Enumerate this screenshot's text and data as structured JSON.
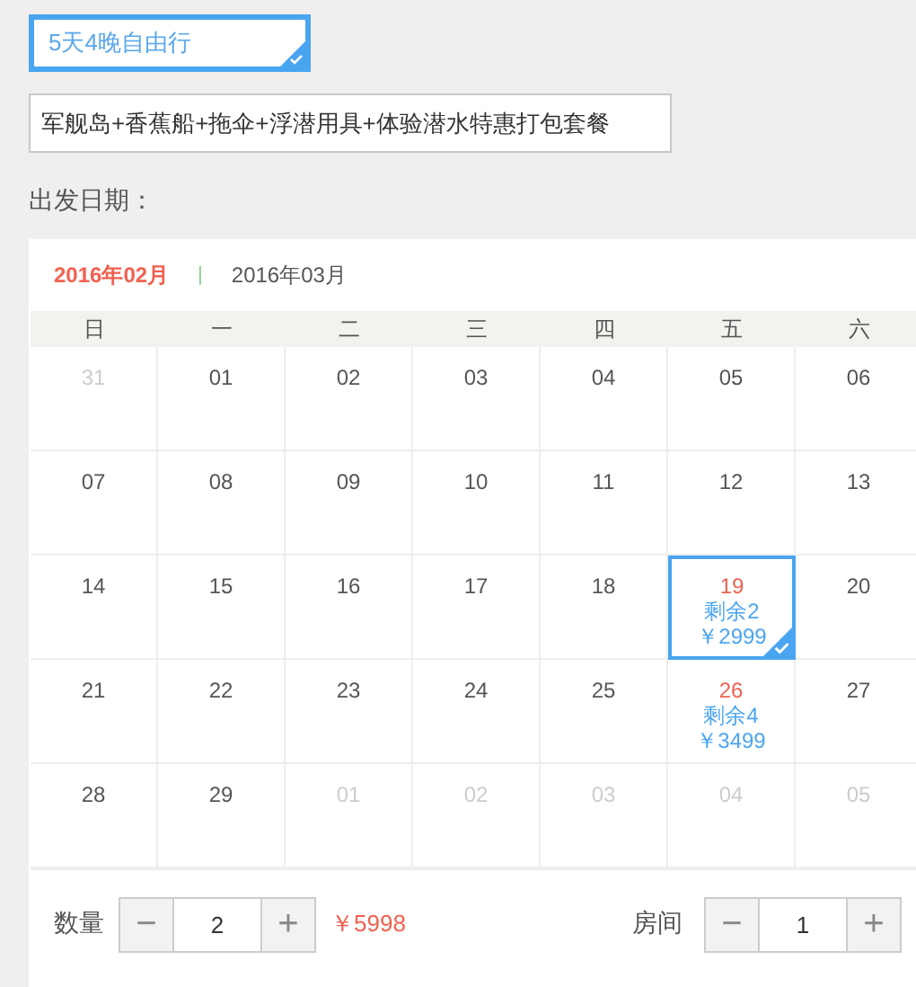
{
  "packages": [
    {
      "label": "5天4晚自由行",
      "selected": true
    }
  ],
  "options": [
    {
      "label": "军舰岛+香蕉船+拖伞+浮潜用具+体验潜水特惠打包套餐",
      "selected": false
    }
  ],
  "date_label": "出发日期：",
  "months": [
    {
      "label": "2016年02月",
      "selected": true
    },
    {
      "label": "2016年03月",
      "selected": false
    }
  ],
  "separator": "|",
  "weekdays": [
    "日",
    "一",
    "二",
    "三",
    "四",
    "五",
    "六"
  ],
  "weeks": [
    [
      {
        "day": "31",
        "muted": true,
        "selected": false
      },
      {
        "day": "01",
        "muted": false,
        "selected": false
      },
      {
        "day": "02",
        "muted": false,
        "selected": false
      },
      {
        "day": "03",
        "muted": false,
        "selected": false
      },
      {
        "day": "04",
        "muted": false,
        "selected": false
      },
      {
        "day": "05",
        "muted": false,
        "selected": false
      },
      {
        "day": "06",
        "muted": false,
        "selected": false
      }
    ],
    [
      {
        "day": "07",
        "muted": false,
        "selected": false
      },
      {
        "day": "08",
        "muted": false,
        "selected": false
      },
      {
        "day": "09",
        "muted": false,
        "selected": false
      },
      {
        "day": "10",
        "muted": false,
        "selected": false
      },
      {
        "day": "11",
        "muted": false,
        "selected": false
      },
      {
        "day": "12",
        "muted": false,
        "selected": false
      },
      {
        "day": "13",
        "muted": false,
        "selected": false
      }
    ],
    [
      {
        "day": "14",
        "muted": false,
        "selected": false
      },
      {
        "day": "15",
        "muted": false,
        "selected": false
      },
      {
        "day": "16",
        "muted": false,
        "selected": false
      },
      {
        "day": "17",
        "muted": false,
        "selected": false
      },
      {
        "day": "18",
        "muted": false,
        "selected": false
      },
      {
        "day": "19",
        "muted": false,
        "selected": true,
        "stock": "剩余2",
        "price": "￥2999"
      },
      {
        "day": "20",
        "muted": false,
        "selected": false
      }
    ],
    [
      {
        "day": "21",
        "muted": false,
        "selected": false
      },
      {
        "day": "22",
        "muted": false,
        "selected": false
      },
      {
        "day": "23",
        "muted": false,
        "selected": false
      },
      {
        "day": "24",
        "muted": false,
        "selected": false
      },
      {
        "day": "25",
        "muted": false,
        "selected": false
      },
      {
        "day": "26",
        "muted": false,
        "selected": false,
        "stock": "剩余4",
        "price": "￥3499"
      },
      {
        "day": "27",
        "muted": false,
        "selected": false
      }
    ],
    [
      {
        "day": "28",
        "muted": false,
        "selected": false
      },
      {
        "day": "29",
        "muted": false,
        "selected": false
      },
      {
        "day": "01",
        "muted": true,
        "selected": false
      },
      {
        "day": "02",
        "muted": true,
        "selected": false
      },
      {
        "day": "03",
        "muted": true,
        "selected": false
      },
      {
        "day": "04",
        "muted": true,
        "selected": false
      },
      {
        "day": "05",
        "muted": true,
        "selected": false
      }
    ]
  ],
  "quantity": {
    "label": "数量",
    "minus": "−",
    "value": "2",
    "plus": "+",
    "total": "￥5998"
  },
  "rooms": {
    "label": "房间",
    "minus": "−",
    "value": "1",
    "plus": "+"
  }
}
